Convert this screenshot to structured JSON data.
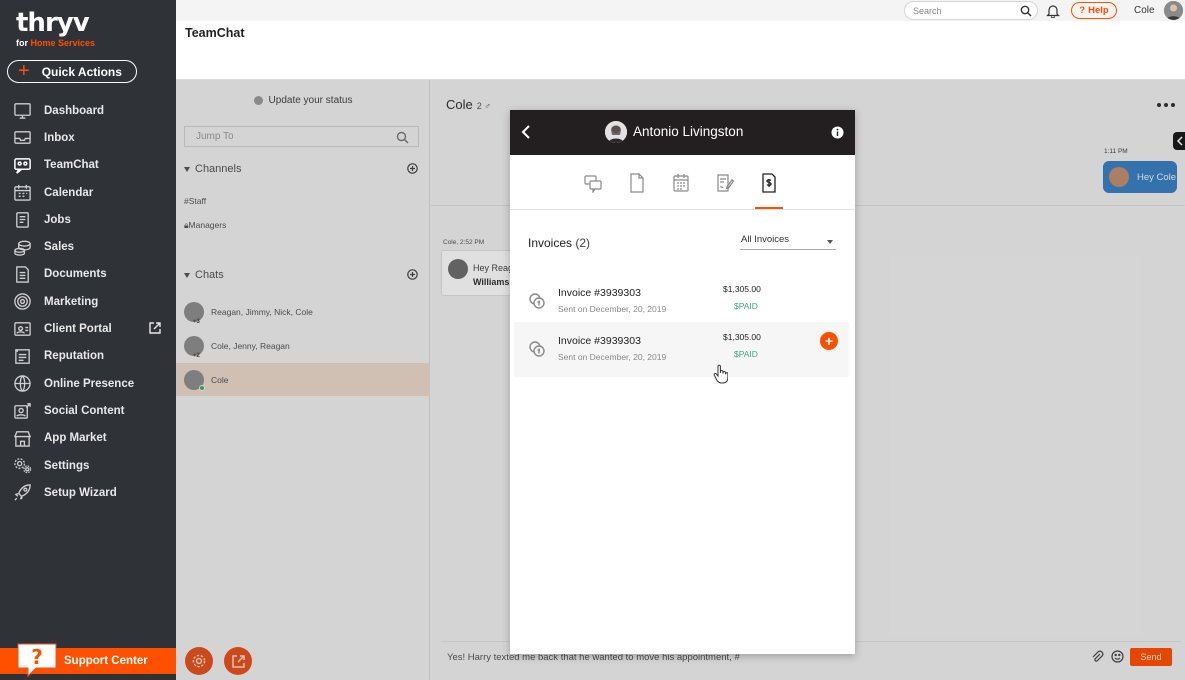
{
  "app": {
    "logo_main": "thryv",
    "logo_sub_prefix": "for ",
    "logo_sub_accent": "Home Services",
    "quick_actions": "Quick Actions",
    "support_center": "Support Center"
  },
  "sidebar": {
    "items": [
      {
        "label": "Dashboard",
        "icon": "dashboard-icon"
      },
      {
        "label": "Inbox",
        "icon": "inbox-icon"
      },
      {
        "label": "TeamChat",
        "icon": "teamchat-icon"
      },
      {
        "label": "Calendar",
        "icon": "calendar-icon"
      },
      {
        "label": "Jobs",
        "icon": "jobs-icon"
      },
      {
        "label": "Sales",
        "icon": "sales-icon"
      },
      {
        "label": "Documents",
        "icon": "documents-icon"
      },
      {
        "label": "Marketing",
        "icon": "marketing-icon"
      },
      {
        "label": "Client Portal",
        "icon": "client-portal-icon"
      },
      {
        "label": "Reputation",
        "icon": "reputation-icon"
      },
      {
        "label": "Online Presence",
        "icon": "globe-icon"
      },
      {
        "label": "Social Content",
        "icon": "social-content-icon"
      },
      {
        "label": "App Market",
        "icon": "app-market-icon"
      },
      {
        "label": "Settings",
        "icon": "settings-icon"
      },
      {
        "label": "Setup Wizard",
        "icon": "rocket-icon"
      }
    ]
  },
  "topbar": {
    "search_placeholder": "Search",
    "help": "Help",
    "user": "Cole"
  },
  "page": {
    "title": "TeamChat"
  },
  "chatlist": {
    "status": "Update your status",
    "jump_placeholder": "Jump To",
    "channels_header": "Channels",
    "channels": [
      "#Staff",
      "Managers"
    ],
    "chats_header": "Chats",
    "chats": [
      {
        "label": "Reagan, Jimmy, Nick, Cole",
        "count": "+3"
      },
      {
        "label": "Cole, Jenny, Reagan",
        "count": "+2"
      },
      {
        "label": "Cole",
        "count": ""
      }
    ]
  },
  "conversation": {
    "title": "Cole",
    "member_count": "2",
    "message_meta": "Cole, 2:52 PM",
    "message_line1": "Hey Reagan,",
    "message_line2": "Williams",
    "right_time": "1:11 PM",
    "right_bubble": "Hey Cole",
    "composer_text": "Yes! Harry texted me back that he wanted to move his appointment, #",
    "send": "Send"
  },
  "modal": {
    "contact_name": "Antonio Livingston",
    "invoices_label": "Invoices",
    "invoices_count": "(2)",
    "filter": "All Invoices",
    "invoices": [
      {
        "title": "Invoice #3939303",
        "sent": "Sent on December, 20, 2019",
        "amount": "$1,305.00",
        "status": "$PAID"
      },
      {
        "title": "Invoice #3939303",
        "sent": "Sent on December, 20, 2019",
        "amount": "$1,305.00",
        "status": "$PAID"
      }
    ]
  },
  "colors": {
    "brand_orange": "#ff5000",
    "sidebar_bg": "#2f3237",
    "modal_header": "#231f20",
    "paid_green": "#3daa7c"
  }
}
